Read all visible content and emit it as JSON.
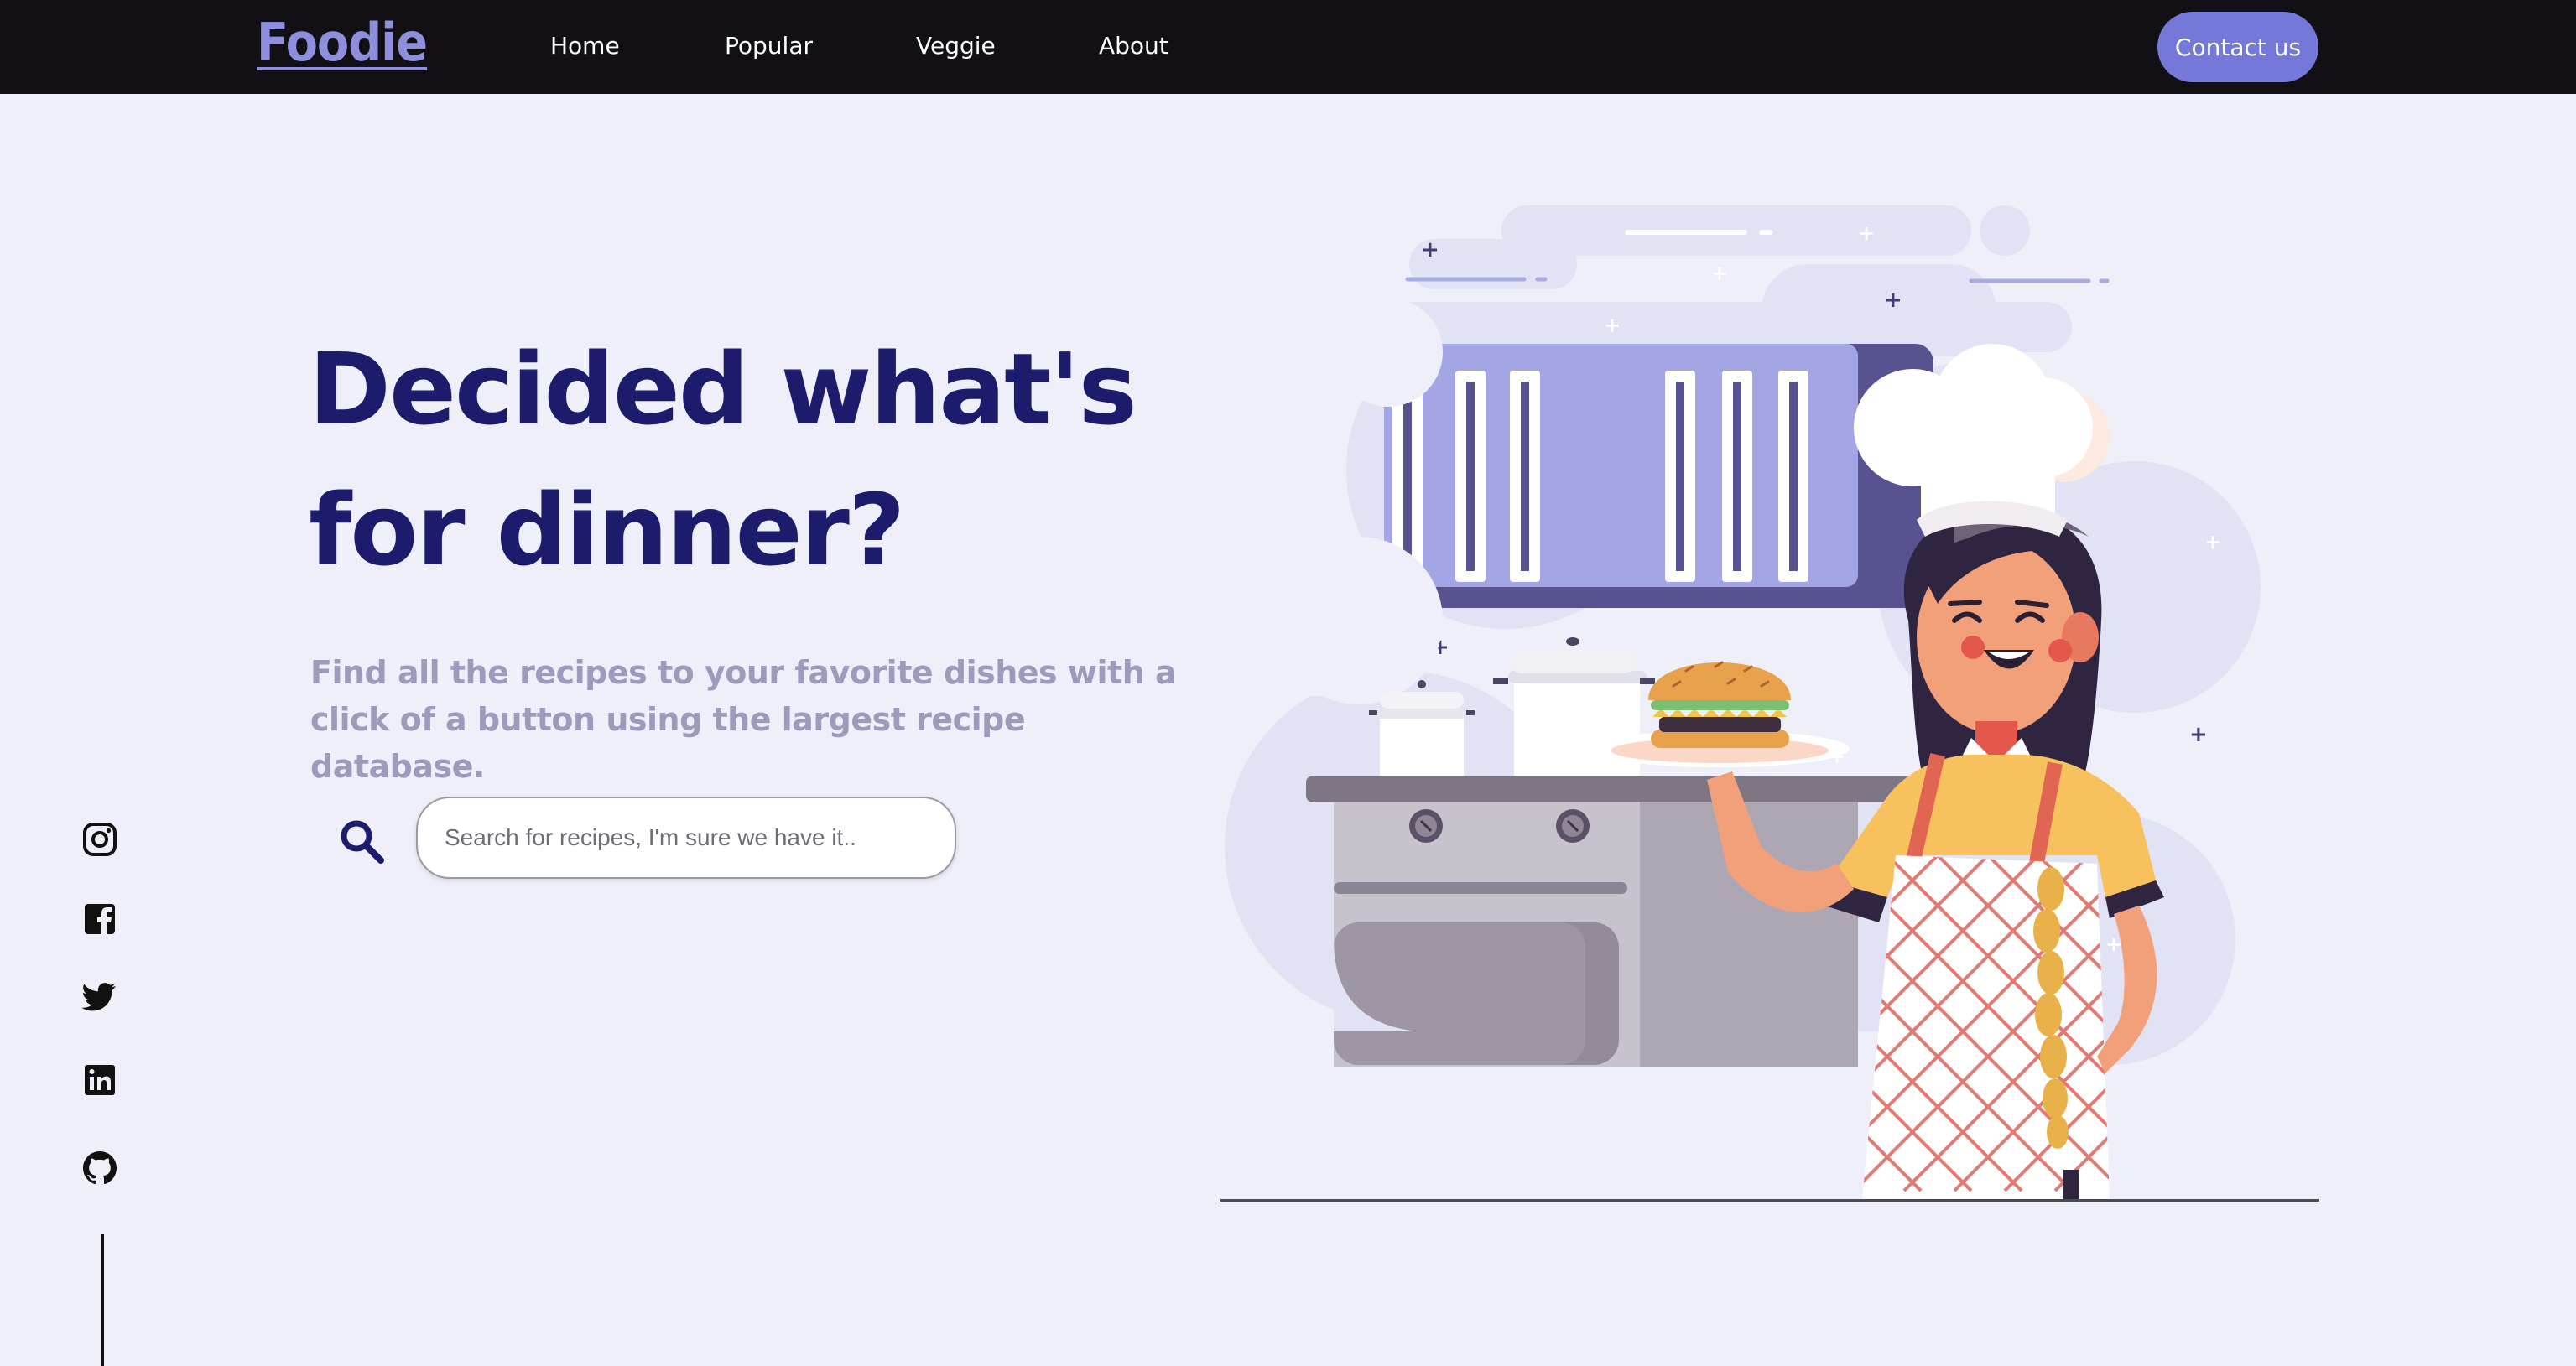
{
  "nav": {
    "logo": "Foodie",
    "links": [
      "Home",
      "Popular",
      "Veggie",
      "About"
    ],
    "contact_label": "Contact us"
  },
  "hero": {
    "title_line1": "Decided what's",
    "title_line2": "for dinner?",
    "subtitle": "Find all the recipes to your favorite dishes with a click of a button using the largest recipe database."
  },
  "search": {
    "placeholder": "Search for recipes, I'm sure we have it..",
    "value": ""
  },
  "social": {
    "icons": [
      "instagram-icon",
      "facebook-icon",
      "twitter-icon",
      "linkedin-icon",
      "github-icon"
    ]
  },
  "colors": {
    "navbar_bg": "#121014",
    "logo": "#8d8fdc",
    "accent": "#7478d8",
    "title": "#1d1b6b",
    "subtitle": "#9b9cbb",
    "page_bg": "#eeeff8"
  }
}
